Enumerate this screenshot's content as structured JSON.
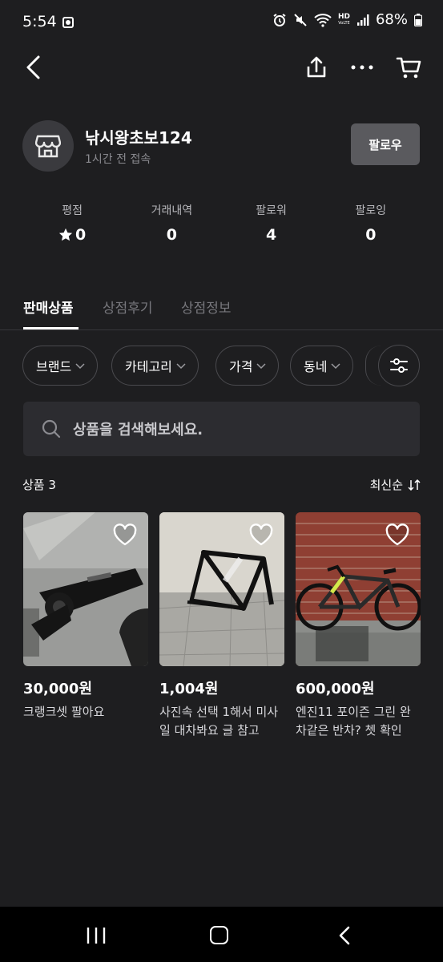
{
  "status_bar": {
    "time": "5:54",
    "battery": "68%",
    "hd_label": "HD",
    "hd_sub": "VoLTE"
  },
  "header": {
    "back_icon": "back-chevron-icon",
    "share_icon": "share-icon",
    "more_icon": "more-dots-icon",
    "cart_icon": "cart-icon"
  },
  "profile": {
    "name": "낚시왕초보124",
    "last_seen": "1시간 전 접속",
    "follow_label": "팔로우",
    "avatar_icon": "store-icon"
  },
  "stats": [
    {
      "label": "평점",
      "value": "0",
      "icon": "star-icon"
    },
    {
      "label": "거래내역",
      "value": "0"
    },
    {
      "label": "팔로워",
      "value": "4"
    },
    {
      "label": "팔로잉",
      "value": "0"
    }
  ],
  "tabs": [
    {
      "label": "판매상품",
      "active": true
    },
    {
      "label": "상점후기",
      "active": false
    },
    {
      "label": "상점정보",
      "active": false
    }
  ],
  "filters": [
    {
      "label": "브랜드"
    },
    {
      "label": "카테고리"
    },
    {
      "label": "가격"
    },
    {
      "label": "동네"
    }
  ],
  "search": {
    "placeholder": "상품을 검색해보세요."
  },
  "list": {
    "count_label": "상품 3",
    "sort_label": "최신순"
  },
  "products": [
    {
      "price": "30,000원",
      "title": "크랭크셋 팔아요"
    },
    {
      "price": "1,004원",
      "title": "사진속 선택 1해서 미사일 대차봐요 글 참고"
    },
    {
      "price": "600,000원",
      "title": "엔진11 포이즌 그린 완차같은 반차? 쳇 확인"
    }
  ],
  "colors": {
    "background": "#1e1e20",
    "surface": "#2c2c30",
    "follow_button": "#5a5a5e",
    "muted_text": "#8b8b90"
  }
}
